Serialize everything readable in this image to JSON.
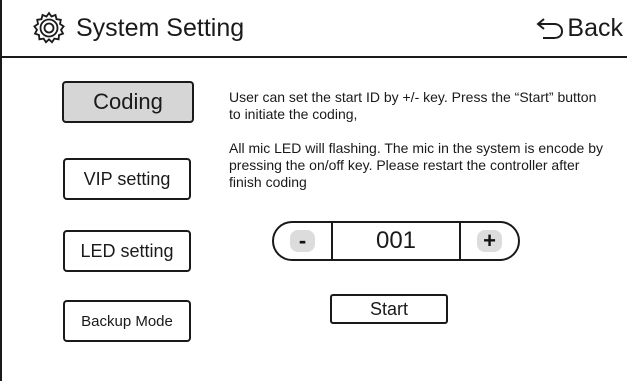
{
  "header": {
    "title": "System Setting",
    "back_label": "Back",
    "gear_icon": "gear-icon",
    "back_icon": "back-arrow-icon"
  },
  "sidebar": {
    "items": [
      {
        "label": "Coding",
        "active": true
      },
      {
        "label": "VIP setting",
        "active": false
      },
      {
        "label": "LED setting",
        "active": false
      },
      {
        "label": "Backup Mode",
        "active": false
      }
    ]
  },
  "main": {
    "description_1": "User can set the start ID by +/- key. Press the “Start” button to initiate the coding,",
    "description_2": "All mic LED will flashing. The mic in the system is encode by pressing the on/off key. Please restart the controller after finish coding",
    "stepper": {
      "minus_label": "-",
      "value": "001",
      "plus_label": "+"
    },
    "start_label": "Start"
  },
  "colors": {
    "active_button_bg": "#d6d6d6",
    "stepper_key_bg": "#dcdcdc",
    "line": "#1a1a1a"
  }
}
